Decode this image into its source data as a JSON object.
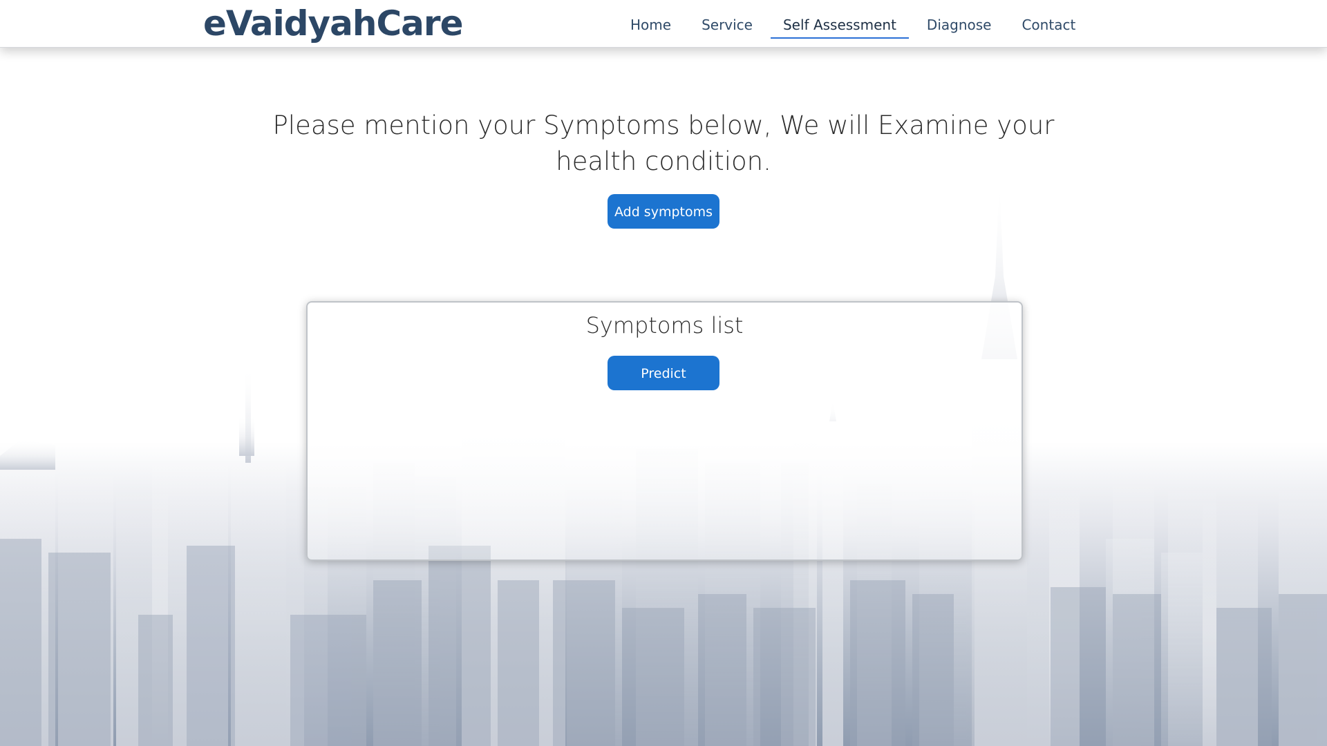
{
  "brand": "eVaidyahCare",
  "nav": {
    "items": [
      {
        "label": "Home"
      },
      {
        "label": "Service"
      },
      {
        "label": "Self Assessment"
      },
      {
        "label": "Diagnose"
      },
      {
        "label": "Contact"
      }
    ],
    "active": "Self Assessment"
  },
  "main": {
    "heading": "Please mention your Symptoms below, We will Examine your health condition.",
    "add_button": "Add symptoms"
  },
  "card": {
    "title": "Symptoms list",
    "predict_button": "Predict"
  },
  "colors": {
    "brand": "#2c4766",
    "accent": "#1c74d0",
    "nav_underline": "#2a6fd6"
  }
}
